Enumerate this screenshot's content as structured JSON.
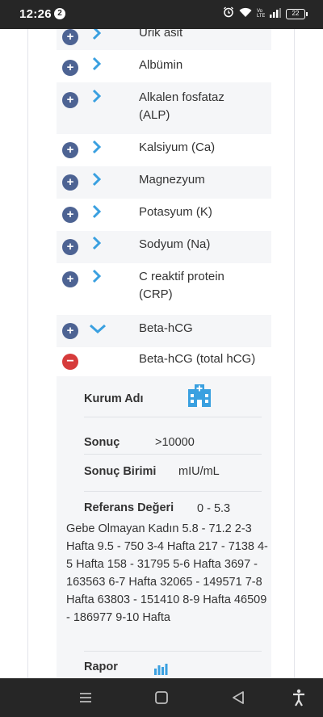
{
  "status_bar": {
    "time": "12:26",
    "notification_count": "2",
    "battery": "22"
  },
  "tests": [
    {
      "label": "Ürik asit",
      "expanded": false
    },
    {
      "label": "Albümin",
      "expanded": false
    },
    {
      "label": "Alkalen fosfataz (ALP)",
      "expanded": false
    },
    {
      "label": "Kalsiyum (Ca)",
      "expanded": false
    },
    {
      "label": "Magnezyum",
      "expanded": false
    },
    {
      "label": "Potasyum (K)",
      "expanded": false
    },
    {
      "label": "Sodyum (Na)",
      "expanded": false
    },
    {
      "label": "C reaktif protein (CRP)",
      "expanded": false
    },
    {
      "label": "Beta-hCG",
      "expanded": true
    },
    {
      "label": "Beta-hCG (total hCG)",
      "expanded": true
    }
  ],
  "detail": {
    "institution_label": "Kurum Adı",
    "result_label": "Sonuç",
    "result_value": ">10000",
    "unit_label": "Sonuç Birimi",
    "unit_value": "mIU/mL",
    "reference_label": "Referans Değeri",
    "reference_value": "0 - 5.3",
    "reference_note": "Gebe Olmayan Kadın 5.8 - 71.2 2-3 Hafta 9.5 - 750 3-4 Hafta 217 - 7138 4-5 Hafta 158 - 31795 5-6 Hafta 3697 - 163563 6-7 Hafta 32065 - 149571 7-8 Hafta 63803 - 151410 8-9 Hafta 46509 - 186977 9-10 Hafta",
    "report_label": "Rapor"
  },
  "colors": {
    "plus": "#4d6393",
    "minus": "#d63b3b",
    "chevron": "#3aa0e0",
    "row_alt": "#f5f6f8"
  }
}
